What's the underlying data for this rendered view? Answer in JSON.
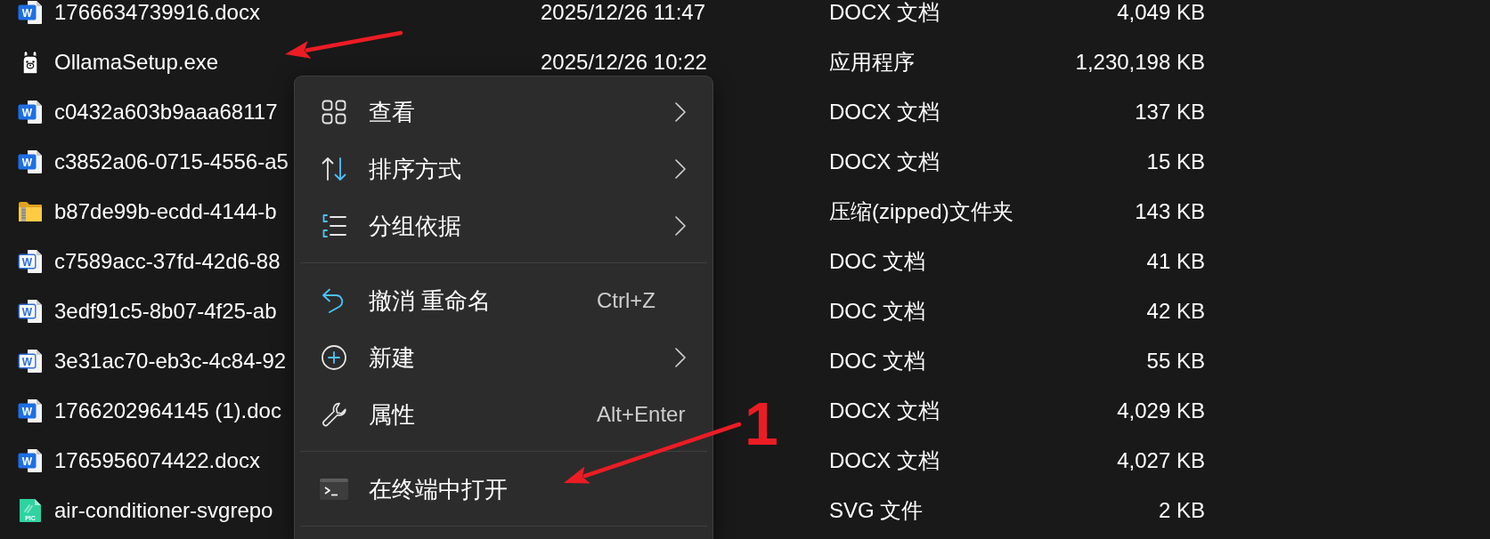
{
  "files": [
    {
      "kind": "docx",
      "icon_text": "W",
      "name": "1766634739916.docx",
      "date": "2025/12/26 11:47",
      "type": "DOCX 文档",
      "size": "4,049 KB"
    },
    {
      "kind": "exe",
      "name": "OllamaSetup.exe",
      "date": "2025/12/26 10:22",
      "type": "应用程序",
      "size": "1,230,198 KB"
    },
    {
      "kind": "docx",
      "icon_text": "W",
      "name": "c0432a603b9aaa68117",
      "type": "DOCX 文档",
      "size": "137 KB"
    },
    {
      "kind": "docx",
      "icon_text": "W",
      "name": "c3852a06-0715-4556-a5",
      "type": "DOCX 文档",
      "size": "15 KB"
    },
    {
      "kind": "zip",
      "name": "b87de99b-ecdd-4144-b",
      "type": "压缩(zipped)文件夹",
      "size": "143 KB"
    },
    {
      "kind": "doc",
      "icon_text": "W",
      "name": "c7589acc-37fd-42d6-88",
      "type": "DOC 文档",
      "size": "41 KB"
    },
    {
      "kind": "doc",
      "icon_text": "W",
      "name": "3edf91c5-8b07-4f25-ab",
      "type": "DOC 文档",
      "size": "42 KB"
    },
    {
      "kind": "doc",
      "icon_text": "W",
      "name": "3e31ac70-eb3c-4c84-92",
      "type": "DOC 文档",
      "size": "55 KB"
    },
    {
      "kind": "docx",
      "icon_text": "W",
      "name": "1766202964145 (1).doc",
      "type": "DOCX 文档",
      "size": "4,029 KB"
    },
    {
      "kind": "docx",
      "icon_text": "W",
      "name": "1765956074422.docx",
      "type": "DOCX 文档",
      "size": "4,027 KB"
    },
    {
      "kind": "svg",
      "icon_text": "PIC",
      "name": "air-conditioner-svgrepo",
      "type": "SVG 文件",
      "size": "2 KB"
    }
  ],
  "context_menu": {
    "items": [
      {
        "kind": "command",
        "label": "查看",
        "submenu": true
      },
      {
        "kind": "command",
        "label": "排序方式",
        "submenu": true
      },
      {
        "kind": "command",
        "label": "分组依据",
        "submenu": true
      },
      {
        "kind": "separator"
      },
      {
        "kind": "command",
        "label": "撤消 重命名",
        "shortcut": "Ctrl+Z",
        "submenu": false
      },
      {
        "kind": "command",
        "label": "新建",
        "submenu": true
      },
      {
        "kind": "command",
        "label": "属性",
        "shortcut": "Alt+Enter",
        "submenu": false
      },
      {
        "kind": "separator"
      },
      {
        "kind": "command",
        "label": "在终端中打开",
        "submenu": false
      },
      {
        "kind": "separator"
      }
    ]
  },
  "annotations": [
    {
      "kind": "arrow"
    },
    {
      "kind": "arrow",
      "label": "1"
    }
  ]
}
